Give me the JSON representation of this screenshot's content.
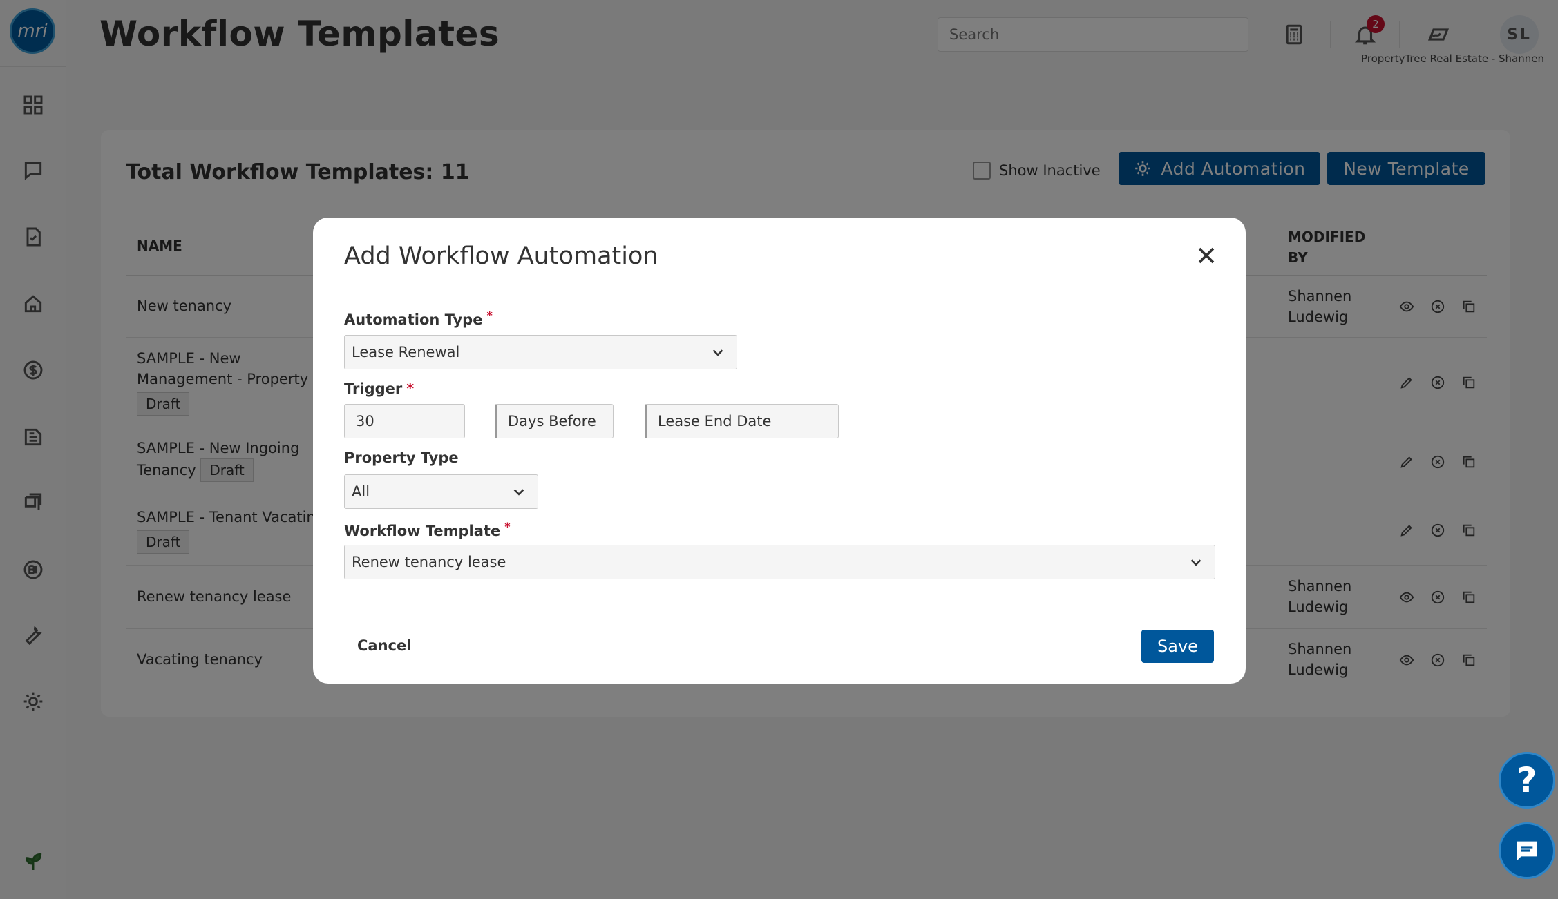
{
  "logo": {
    "text": "mri"
  },
  "sidebar": {
    "items": [
      {
        "name": "dashboard-icon"
      },
      {
        "name": "messages-icon"
      },
      {
        "name": "tasks-icon"
      },
      {
        "name": "property-icon"
      },
      {
        "name": "accounting-icon"
      },
      {
        "name": "reports-icon"
      },
      {
        "name": "maintenance-icon"
      },
      {
        "name": "bi-icon"
      },
      {
        "name": "tools-icon"
      },
      {
        "name": "settings-icon"
      }
    ],
    "footer_icon": "leaf-icon"
  },
  "header": {
    "title": "Workflow Templates",
    "search_placeholder": "Search",
    "notification_count": "2",
    "avatar_initials": "SL",
    "org_label": "PropertyTree Real Estate - Shannen"
  },
  "card": {
    "total_label": "Total Workflow Templates: 11",
    "show_inactive_label": "Show Inactive",
    "add_automation_label": "Add Automation",
    "new_template_label": "New Template",
    "columns": {
      "name": "NAME",
      "modified_by_line1": "MODIFIED",
      "modified_by_line2": "BY"
    },
    "rows": [
      {
        "name": "New tenancy",
        "modified_by_first": "Shannen",
        "modified_by_last": "Ludewig",
        "actions": [
          "view",
          "deactivate",
          "copy"
        ]
      },
      {
        "name_line1": "SAMPLE - New",
        "name_line2": "Management - Property",
        "badge": "Draft",
        "actions": [
          "edit",
          "deactivate",
          "copy"
        ]
      },
      {
        "name_line1": "SAMPLE - New Ingoing",
        "name_line2": "Tenancy",
        "badge": "Draft",
        "actions": [
          "edit",
          "deactivate",
          "copy"
        ]
      },
      {
        "name_line1": "SAMPLE - Tenant Vacating",
        "badge": "Draft",
        "actions": [
          "edit",
          "deactivate",
          "copy"
        ]
      },
      {
        "name": "Renew tenancy lease",
        "modified_by_first": "Shannen",
        "modified_by_last": "Ludewig",
        "actions": [
          "view",
          "deactivate",
          "copy"
        ]
      },
      {
        "name": "Vacating tenancy",
        "modified_by_first": "Shannen",
        "modified_by_last": "Ludewig",
        "actions": [
          "view",
          "deactivate",
          "copy"
        ]
      }
    ]
  },
  "modal": {
    "title": "Add Workflow Automation",
    "automation_type_label": "Automation Type",
    "automation_type_value": "Lease Renewal",
    "trigger_label": "Trigger",
    "trigger_days": "30",
    "trigger_direction": "Days Before",
    "trigger_reference": "Lease End Date",
    "property_type_label": "Property Type",
    "property_type_value": "All",
    "workflow_template_label": "Workflow Template",
    "workflow_template_value": "Renew tenancy lease",
    "cancel_label": "Cancel",
    "save_label": "Save"
  },
  "floating": {
    "help_label": "?",
    "chat_icon": "chat-icon"
  },
  "colors": {
    "primary": "#00579b",
    "badge_red": "#c8102e",
    "overlay": "rgba(0,0,0,0.5)"
  }
}
